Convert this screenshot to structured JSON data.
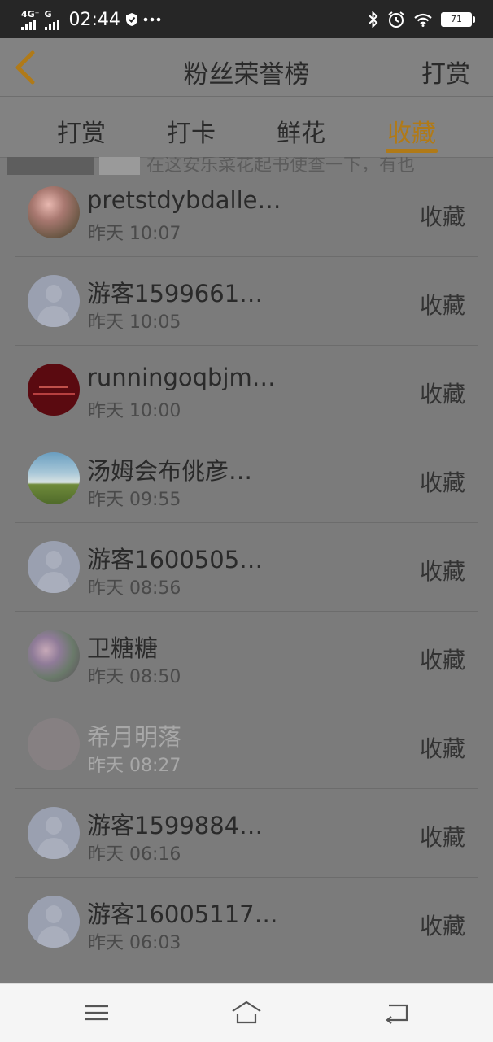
{
  "status_bar": {
    "network_4g": "4G⁺",
    "network_g": "G",
    "time": "02:44",
    "battery": "71",
    "icons": [
      "shield-icon",
      "more-dots-icon",
      "bluetooth-icon",
      "alarm-icon",
      "wifi-icon",
      "battery-icon"
    ]
  },
  "header": {
    "title": "粉丝荣誉榜",
    "back_icon": "chevron-left-icon",
    "right_button": "打赏",
    "accent_color": "#b07a18"
  },
  "tabs": [
    {
      "label": "打赏",
      "active": false
    },
    {
      "label": "打卡",
      "active": false
    },
    {
      "label": "鲜花",
      "active": false
    },
    {
      "label": "收藏",
      "active": true
    }
  ],
  "peek_text": "在这安乐菜花起书使查一下，有也",
  "list": [
    {
      "name": "pretstdybdalle…",
      "time": "昨天 10:07",
      "action": "收藏",
      "avatar": "illustration-avatar"
    },
    {
      "name": "游客1599661…",
      "time": "昨天 10:05",
      "action": "收藏",
      "avatar": "default-avatar"
    },
    {
      "name": "runningoqbjm…",
      "time": "昨天 10:00",
      "action": "收藏",
      "avatar": "red-text-avatar"
    },
    {
      "name": "汤姆会布佻彦…",
      "time": "昨天 09:55",
      "action": "收藏",
      "avatar": "sky-landscape-avatar"
    },
    {
      "name": "游客1600505…",
      "time": "昨天 08:56",
      "action": "收藏",
      "avatar": "default-avatar"
    },
    {
      "name": "卫糖糖",
      "time": "昨天 08:50",
      "action": "收藏",
      "avatar": "floral-avatar"
    },
    {
      "name": "希月明落",
      "time": "昨天 08:27",
      "action": "收藏",
      "avatar": "faded-avatar"
    },
    {
      "name": "游客1599884…",
      "time": "昨天 06:16",
      "action": "收藏",
      "avatar": "default-avatar"
    },
    {
      "name": "游客16005117…",
      "time": "昨天 06:03",
      "action": "收藏",
      "avatar": "default-avatar"
    }
  ],
  "nav_bar": {
    "icons": [
      "menu-icon",
      "home-icon",
      "back-icon"
    ]
  }
}
